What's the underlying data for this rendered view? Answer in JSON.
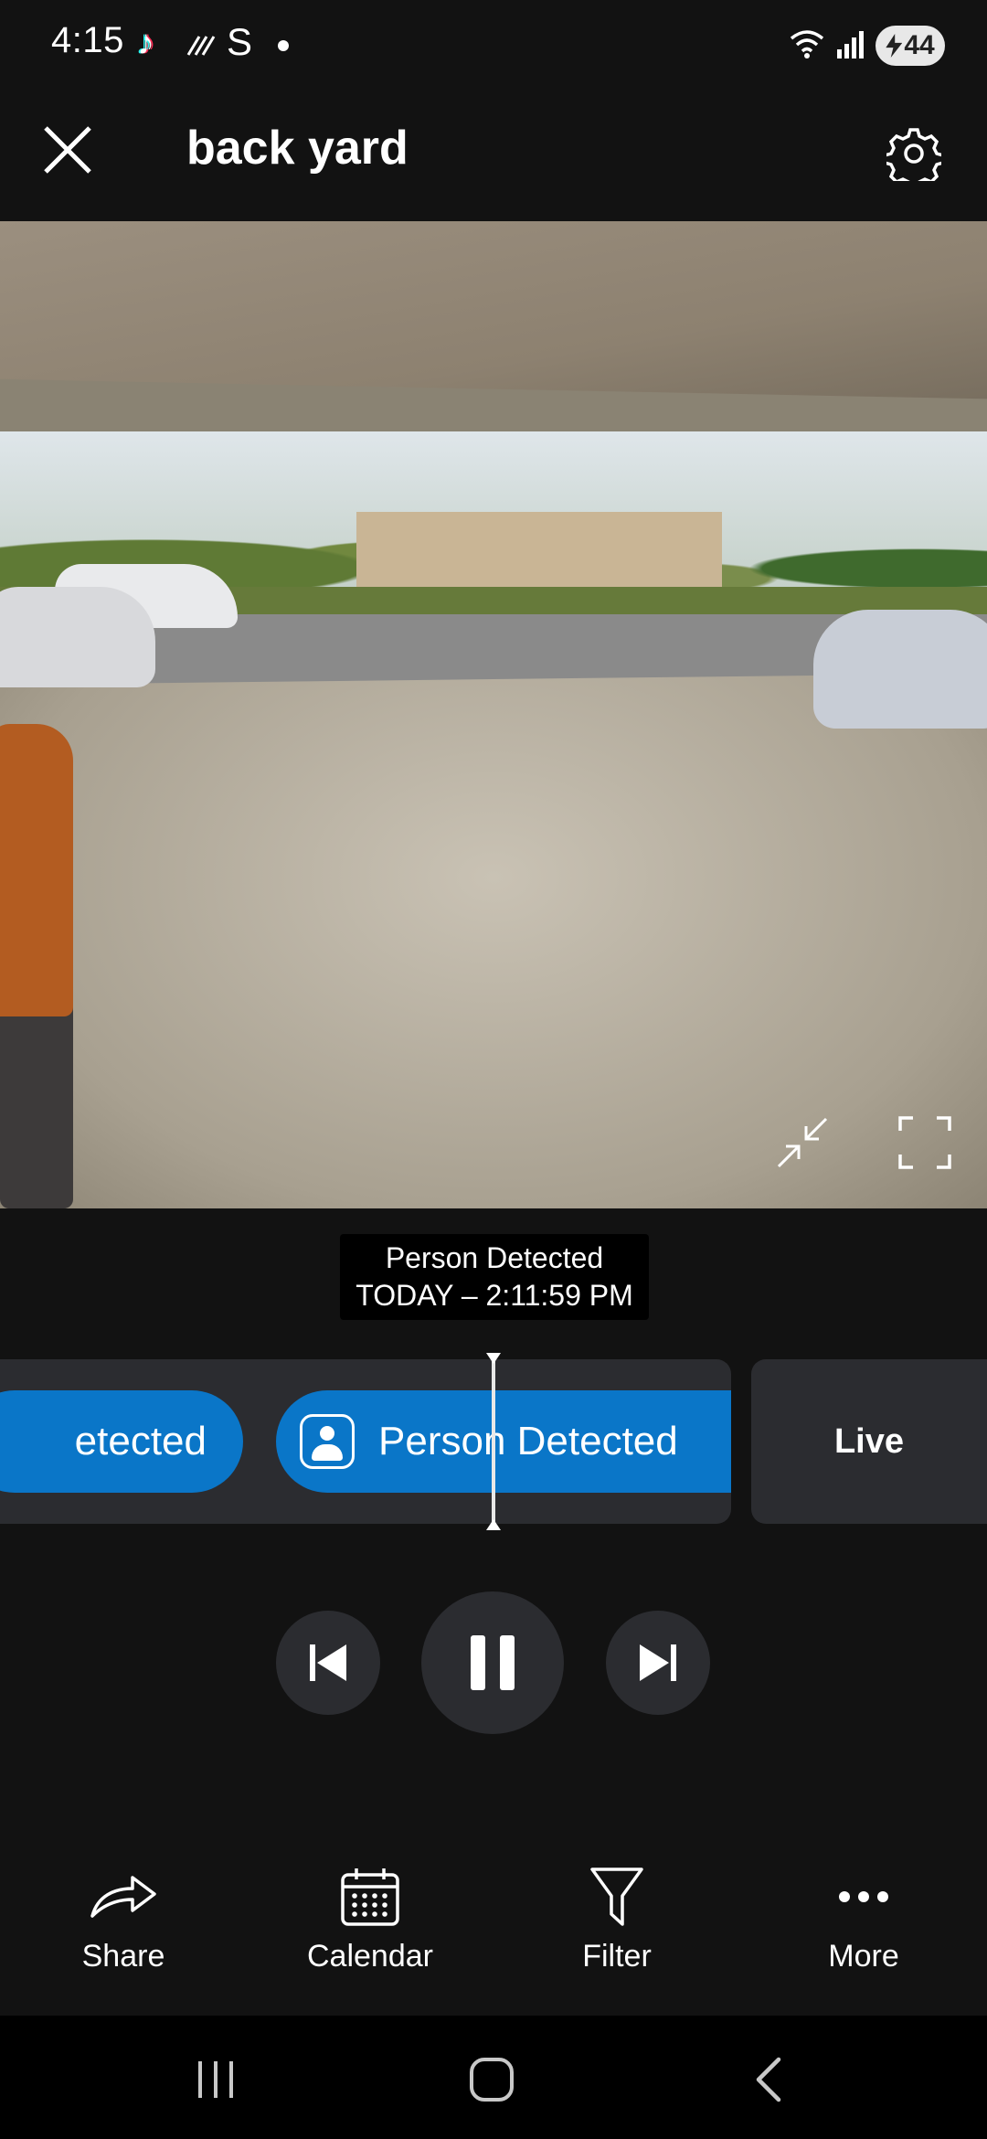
{
  "status_bar": {
    "time": "4:15",
    "tiktok_glyph": "♪",
    "signal_glyph": "S",
    "battery": "44"
  },
  "header": {
    "title": "back yard"
  },
  "event_caption": {
    "label": "Person Detected",
    "time": "TODAY – 2:11:59 PM"
  },
  "timeline": {
    "prev_event_label": "etected",
    "current_event_label": "Person Detected",
    "live_label": "Live"
  },
  "toolbar": {
    "share": "Share",
    "calendar": "Calendar",
    "filter": "Filter",
    "more": "More"
  },
  "colors": {
    "background": "#121212",
    "event_blue": "#0a76c8",
    "panel": "#2b2c30"
  },
  "icons": [
    "close-icon",
    "gear-icon",
    "minimize-icon",
    "fullscreen-icon",
    "person-icon",
    "skip-previous-icon",
    "pause-icon",
    "skip-next-icon",
    "share-icon",
    "calendar-icon",
    "filter-icon",
    "more-icon",
    "recents-icon",
    "home-icon",
    "back-icon"
  ]
}
